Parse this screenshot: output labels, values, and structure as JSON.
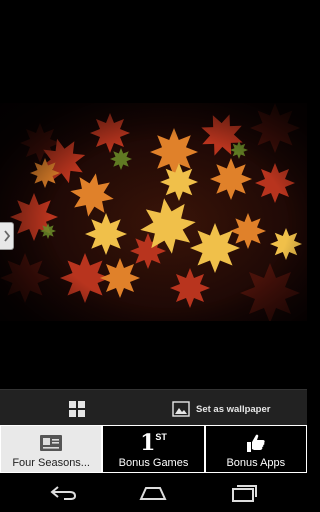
{
  "viewer": {
    "image_icon": "autumn-leaves-photo",
    "prev_icon": "chevron-right-icon"
  },
  "toolbar": {
    "grid_icon": "grid-icon",
    "wallpaper_icon": "image-icon",
    "wallpaper_label": "Set as wallpaper"
  },
  "tabs": [
    {
      "label": "Four Seasons...",
      "icon": "id-card-icon",
      "active": true
    },
    {
      "label": "Bonus Games",
      "icon": "first-place-icon",
      "icon_text": "1",
      "icon_sup": "ST",
      "active": false
    },
    {
      "label": "Bonus Apps",
      "icon": "thumbs-up-icon",
      "active": false
    }
  ],
  "navbar": {
    "back_icon": "back-icon",
    "home_icon": "home-icon",
    "recents_icon": "recents-icon"
  },
  "colors": {
    "toolbar_bg": "#222222",
    "active_tab_bg": "#e9e9e9",
    "dark_tab_bg": "#000000",
    "leaf_red": "#b8341e",
    "leaf_orange": "#e0812a",
    "leaf_gold": "#f0c04a"
  }
}
